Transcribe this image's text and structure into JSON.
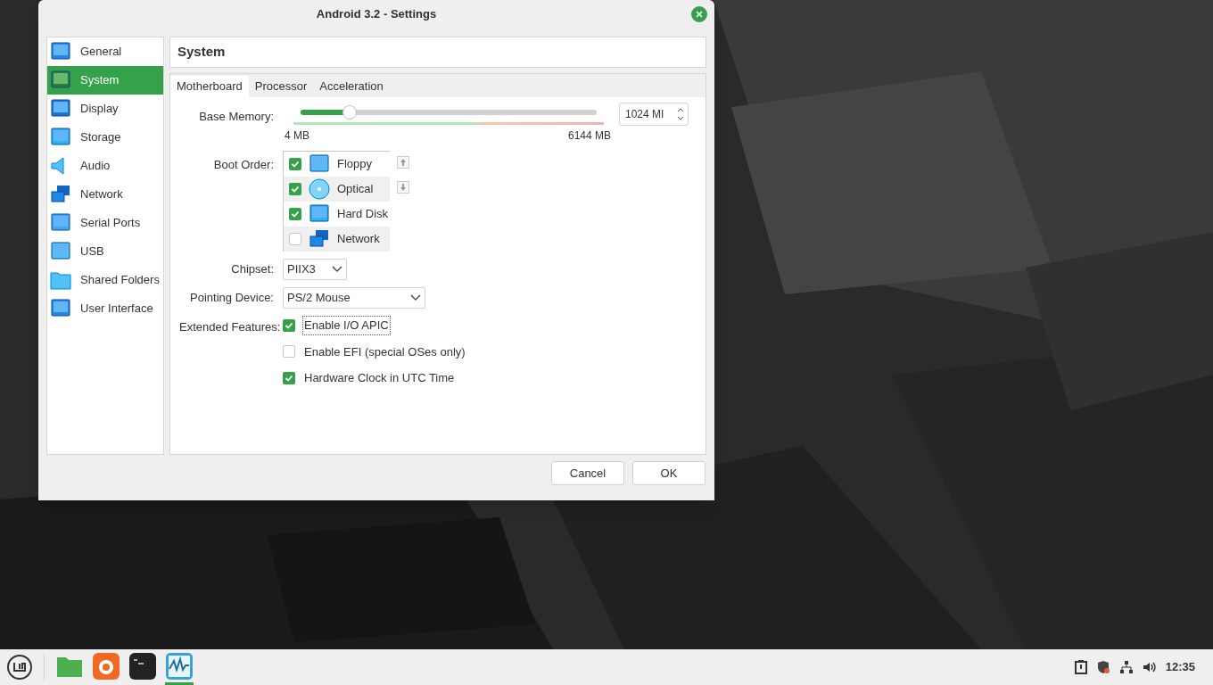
{
  "window": {
    "title": "Android 3.2 - Settings"
  },
  "sidebar": {
    "items": [
      {
        "label": "General",
        "selected": false
      },
      {
        "label": "System",
        "selected": true
      },
      {
        "label": "Display",
        "selected": false
      },
      {
        "label": "Storage",
        "selected": false
      },
      {
        "label": "Audio",
        "selected": false
      },
      {
        "label": "Network",
        "selected": false
      },
      {
        "label": "Serial Ports",
        "selected": false
      },
      {
        "label": "USB",
        "selected": false
      },
      {
        "label": "Shared Folders",
        "selected": false
      },
      {
        "label": "User Interface",
        "selected": false
      }
    ]
  },
  "page_title": "System",
  "tabs": [
    {
      "label": "Motherboard",
      "selected": true
    },
    {
      "label": "Processor",
      "selected": false
    },
    {
      "label": "Acceleration",
      "selected": false
    }
  ],
  "base_memory": {
    "label": "Base Memory:",
    "level": 0.167,
    "value": "1024 MI",
    "min": "4 MB",
    "max": "6144 MB"
  },
  "boot_order": {
    "label": "Boot Order:",
    "items": [
      {
        "label": "Floppy",
        "checked": true
      },
      {
        "label": "Optical",
        "checked": true
      },
      {
        "label": "Hard Disk",
        "checked": true
      },
      {
        "label": "Network",
        "checked": false
      }
    ]
  },
  "chipset": {
    "label": "Chipset:",
    "value": "PIIX3"
  },
  "pointing_device": {
    "label": "Pointing Device:",
    "value": "PS/2 Mouse"
  },
  "extended_features": {
    "label": "Extended Features:",
    "options": [
      {
        "label": "Enable I/O APIC",
        "checked": true,
        "focused": true
      },
      {
        "label": "Enable EFI (special OSes only)",
        "checked": false,
        "focused": false
      },
      {
        "label": "Hardware Clock in UTC Time",
        "checked": true,
        "focused": false
      }
    ]
  },
  "buttons": [
    "Cancel",
    "OK"
  ],
  "taskbar": {
    "apps": [
      {
        "active": false
      },
      {
        "active": false
      },
      {
        "active": false
      },
      {
        "active": true
      }
    ],
    "clock": "12:35"
  }
}
